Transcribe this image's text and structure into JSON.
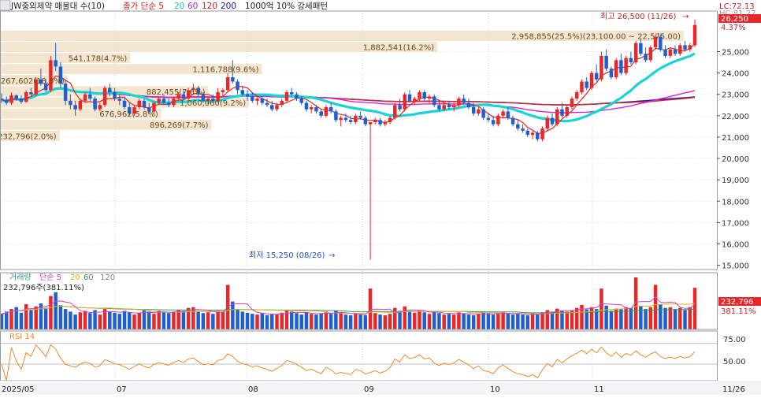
{
  "header": {
    "ticker_label": "JW중외제약 매물대 수(10)",
    "ma_prefix": "종가 단순 5",
    "ma_periods": [
      "20",
      "60",
      "120",
      "200"
    ],
    "volume_info": "1000억 10% 강세패턴"
  },
  "colors": {
    "up": "#e8272b",
    "down": "#1f5fd0",
    "ma5": "#e0281f",
    "ma20": "#19d3d6",
    "ma60": "#e020d8",
    "ma120": "#d12b2b",
    "ma200": "#2020a8",
    "band": "#f1e2c8",
    "rsi": "#f08a2c",
    "vol_ma5": "#d040d0",
    "vol_ma20": "#e0b020",
    "vol_ma60": "#2aa04a"
  },
  "price_panel": {
    "high_annotation": "최고 26,500 (11/26)",
    "low_annotation": "최저 15,250 (08/26)",
    "top_right": {
      "lc": "LC:72.13",
      "hc": "HC:81.27",
      "pct": "4.37%"
    },
    "last_price": "26,250",
    "band_labels": [
      "232,796(2.0%)",
      "896,269(7.7%)",
      "676,962(5.8%)",
      "1,060,060(9.2%)",
      "882,455(7.6%)",
      "267,602(18.0%)",
      "1,116,788(9.6%)",
      "541,178(4.7%)",
      "1,882,541(16.2%)",
      "2,958,855(25.5%)(23,100.00 ~ 22,575.00)"
    ]
  },
  "volume_panel": {
    "label_prefix": "거래량",
    "ma_prefix": "단순 5",
    "ma_periods": [
      "20",
      "60",
      "120"
    ],
    "summary": "232,796주(381.11%)",
    "last_value": "232,796",
    "last_pct": "381.11%"
  },
  "rsi_panel": {
    "label": "RSI 14",
    "ticks": [
      "75.00",
      "50.00"
    ]
  },
  "chart_data": {
    "type": "candlestick",
    "title": "JW중외제약",
    "y_ticks": [
      "25,000",
      "24,000",
      "23,000",
      "22,000",
      "21,000",
      "20,000",
      "19,000",
      "18,000",
      "17,000",
      "16,000",
      "15,000"
    ],
    "ylim": [
      14800,
      26900
    ],
    "x_labels": [
      "2025/05",
      "07",
      "08",
      "09",
      "10",
      "11",
      "11/26"
    ],
    "high": {
      "value": 26500,
      "date": "11/26"
    },
    "low": {
      "value": 15250,
      "date": "08/26"
    },
    "last_close": 26250,
    "volume_profile": [
      {
        "volume": 232796,
        "pct": 2.0
      },
      {
        "volume": 896269,
        "pct": 7.7
      },
      {
        "volume": 676962,
        "pct": 5.8
      },
      {
        "volume": 1060060,
        "pct": 9.2
      },
      {
        "volume": 882455,
        "pct": 7.6
      },
      {
        "volume": 267602,
        "pct": 18.0
      },
      {
        "volume": 1116788,
        "pct": 9.6
      },
      {
        "volume": 541178,
        "pct": 4.7
      },
      {
        "volume": 1882541,
        "pct": 16.2
      },
      {
        "volume": 2958855,
        "pct": 25.5,
        "range": [
          23100,
          22575
        ]
      }
    ],
    "candles": [
      [
        22800,
        23050,
        22600,
        22750
      ],
      [
        22750,
        22900,
        22500,
        22600
      ],
      [
        22600,
        23100,
        22500,
        22950
      ],
      [
        22950,
        23000,
        22700,
        22800
      ],
      [
        22800,
        22950,
        22550,
        22650
      ],
      [
        22650,
        23200,
        22600,
        23100
      ],
      [
        23100,
        23300,
        22900,
        23000
      ],
      [
        23000,
        23800,
        22900,
        23700
      ],
      [
        23700,
        24200,
        23400,
        23500
      ],
      [
        23500,
        23700,
        23100,
        23200
      ],
      [
        23200,
        24800,
        23100,
        24600
      ],
      [
        24600,
        25400,
        24100,
        24300
      ],
      [
        24300,
        24500,
        23300,
        23500
      ],
      [
        23500,
        23700,
        22500,
        22700
      ],
      [
        22700,
        23000,
        22300,
        22500
      ],
      [
        22500,
        22700,
        22000,
        22300
      ],
      [
        22300,
        22800,
        22200,
        22700
      ],
      [
        22700,
        23100,
        22600,
        23000
      ],
      [
        23000,
        23300,
        22700,
        22800
      ],
      [
        22800,
        22900,
        22200,
        22300
      ],
      [
        22300,
        22600,
        22200,
        22500
      ],
      [
        22500,
        23400,
        22400,
        23300
      ],
      [
        23300,
        23500,
        22900,
        23100
      ],
      [
        23100,
        23300,
        22700,
        22800
      ],
      [
        22800,
        23000,
        22500,
        22700
      ],
      [
        22700,
        22900,
        22300,
        22400
      ],
      [
        22400,
        22600,
        22000,
        22100
      ],
      [
        22100,
        22500,
        22000,
        22400
      ],
      [
        22400,
        22800,
        22300,
        22700
      ],
      [
        22700,
        22800,
        22300,
        22400
      ],
      [
        22400,
        22600,
        22100,
        22200
      ],
      [
        22200,
        22700,
        22100,
        22600
      ],
      [
        22600,
        22900,
        22500,
        22800
      ],
      [
        22800,
        23000,
        22500,
        22600
      ],
      [
        22600,
        22800,
        22400,
        22500
      ],
      [
        22500,
        22900,
        22400,
        22800
      ],
      [
        22800,
        23100,
        22700,
        23000
      ],
      [
        23000,
        23200,
        22700,
        22800
      ],
      [
        22800,
        23300,
        22700,
        23200
      ],
      [
        23200,
        23500,
        23000,
        23300
      ],
      [
        23300,
        23400,
        22900,
        23000
      ],
      [
        23000,
        23100,
        22600,
        22700
      ],
      [
        22700,
        22900,
        22500,
        22800
      ],
      [
        22800,
        23000,
        22600,
        22700
      ],
      [
        22700,
        23300,
        22600,
        23100
      ],
      [
        23100,
        23300,
        22900,
        23200
      ],
      [
        23200,
        24000,
        23100,
        23800
      ],
      [
        23800,
        24600,
        23500,
        23600
      ],
      [
        23600,
        23700,
        23000,
        23200
      ],
      [
        23200,
        23400,
        22900,
        23000
      ],
      [
        23000,
        23200,
        22700,
        22900
      ],
      [
        22900,
        23100,
        22600,
        22700
      ],
      [
        22700,
        22900,
        22500,
        22800
      ],
      [
        22800,
        22900,
        22500,
        22600
      ],
      [
        22600,
        22800,
        22400,
        22500
      ],
      [
        22500,
        22700,
        22200,
        22300
      ],
      [
        22300,
        22600,
        22200,
        22500
      ],
      [
        22500,
        22800,
        22400,
        22700
      ],
      [
        22700,
        23200,
        22600,
        23100
      ],
      [
        23100,
        23300,
        22900,
        23000
      ],
      [
        23000,
        23100,
        22700,
        22800
      ],
      [
        22800,
        22900,
        22500,
        22600
      ],
      [
        22600,
        22700,
        22200,
        22300
      ],
      [
        22300,
        22500,
        22100,
        22400
      ],
      [
        22400,
        22500,
        22100,
        22200
      ],
      [
        22200,
        22300,
        21900,
        22000
      ],
      [
        22000,
        22500,
        21900,
        22400
      ],
      [
        22400,
        22600,
        22100,
        22200
      ],
      [
        22200,
        22300,
        21700,
        21800
      ],
      [
        21800,
        22000,
        21500,
        21900
      ],
      [
        21900,
        22100,
        21700,
        21800
      ],
      [
        21800,
        22000,
        21600,
        21700
      ],
      [
        21700,
        22100,
        21600,
        22000
      ],
      [
        22000,
        22200,
        21800,
        21900
      ],
      [
        21900,
        22000,
        21500,
        21600
      ],
      [
        21600,
        21700,
        15250,
        21700
      ],
      [
        21700,
        21900,
        21600,
        21800
      ],
      [
        21800,
        21900,
        21500,
        21600
      ],
      [
        21600,
        21800,
        21500,
        21700
      ],
      [
        21700,
        22000,
        21600,
        21900
      ],
      [
        21900,
        22600,
        21800,
        22500
      ],
      [
        22500,
        22800,
        22200,
        22300
      ],
      [
        22300,
        23100,
        22200,
        23000
      ],
      [
        23000,
        23200,
        22600,
        22700
      ],
      [
        22700,
        22900,
        22500,
        22800
      ],
      [
        22800,
        23200,
        22700,
        23100
      ],
      [
        23100,
        23200,
        22700,
        22800
      ],
      [
        22800,
        23000,
        22600,
        22900
      ],
      [
        22900,
        23000,
        22400,
        22500
      ],
      [
        22500,
        22700,
        22200,
        22300
      ],
      [
        22300,
        22600,
        22200,
        22500
      ],
      [
        22500,
        22700,
        22300,
        22400
      ],
      [
        22400,
        22600,
        22200,
        22500
      ],
      [
        22500,
        22900,
        22400,
        22800
      ],
      [
        22800,
        23000,
        22500,
        22600
      ],
      [
        22600,
        22800,
        22300,
        22400
      ],
      [
        22400,
        22600,
        22000,
        22100
      ],
      [
        22100,
        22400,
        22000,
        22300
      ],
      [
        22300,
        22400,
        21800,
        21900
      ],
      [
        21900,
        22100,
        21700,
        21800
      ],
      [
        21800,
        22000,
        21500,
        21600
      ],
      [
        21600,
        22100,
        21500,
        22000
      ],
      [
        22000,
        22300,
        21900,
        22200
      ],
      [
        22200,
        22400,
        21800,
        21900
      ],
      [
        21900,
        22000,
        21500,
        21600
      ],
      [
        21600,
        21800,
        21300,
        21400
      ],
      [
        21400,
        21600,
        21200,
        21300
      ],
      [
        21300,
        21400,
        21000,
        21100
      ],
      [
        21100,
        21300,
        20900,
        21200
      ],
      [
        21200,
        21300,
        20800,
        20900
      ],
      [
        20900,
        21500,
        20800,
        21400
      ],
      [
        21400,
        22000,
        21300,
        21900
      ],
      [
        21900,
        22100,
        21500,
        21600
      ],
      [
        21600,
        22400,
        21500,
        22300
      ],
      [
        22300,
        22600,
        21900,
        22000
      ],
      [
        22000,
        22500,
        21900,
        22400
      ],
      [
        22400,
        22900,
        22300,
        22800
      ],
      [
        22800,
        23200,
        22700,
        23100
      ],
      [
        23100,
        23700,
        23000,
        23600
      ],
      [
        23600,
        23800,
        23200,
        23300
      ],
      [
        23300,
        24100,
        23200,
        24000
      ],
      [
        24000,
        24400,
        23600,
        23700
      ],
      [
        23700,
        25000,
        23600,
        24800
      ],
      [
        24800,
        25100,
        24100,
        24200
      ],
      [
        24200,
        24300,
        23700,
        23800
      ],
      [
        23800,
        24700,
        23700,
        24600
      ],
      [
        24600,
        24900,
        23900,
        24000
      ],
      [
        24000,
        24800,
        23900,
        24700
      ],
      [
        24700,
        25000,
        24400,
        24500
      ],
      [
        24500,
        25500,
        24400,
        25400
      ],
      [
        25400,
        25600,
        24800,
        24900
      ],
      [
        24900,
        25200,
        24500,
        24600
      ],
      [
        24600,
        25300,
        24500,
        25200
      ],
      [
        25200,
        25800,
        25100,
        25700
      ],
      [
        25700,
        25800,
        25000,
        25100
      ],
      [
        25100,
        25300,
        24700,
        24800
      ],
      [
        24800,
        25200,
        24700,
        25100
      ],
      [
        25100,
        25300,
        24800,
        24900
      ],
      [
        24900,
        25400,
        24800,
        25300
      ],
      [
        25300,
        25500,
        25000,
        25100
      ],
      [
        25100,
        25400,
        25000,
        25300
      ],
      [
        25300,
        26500,
        25200,
        26250
      ]
    ],
    "volumes": [
      42,
      48,
      55,
      60,
      45,
      68,
      52,
      62,
      70,
      58,
      90,
      100,
      65,
      55,
      48,
      40,
      46,
      50,
      44,
      52,
      40,
      55,
      48,
      45,
      42,
      50,
      46,
      40,
      44,
      52,
      48,
      42,
      50,
      46,
      44,
      48,
      52,
      50,
      58,
      60,
      48,
      44,
      46,
      42,
      50,
      48,
      120,
      75,
      55,
      48,
      45,
      42,
      40,
      44,
      38,
      42,
      40,
      45,
      52,
      48,
      44,
      40,
      46,
      42,
      40,
      44,
      48,
      42,
      50,
      45,
      40,
      38,
      42,
      40,
      38,
      110,
      44,
      40,
      38,
      42,
      58,
      50,
      62,
      48,
      45,
      52,
      46,
      42,
      48,
      44,
      40,
      42,
      40,
      46,
      44,
      40,
      38,
      42,
      46,
      44,
      40,
      42,
      46,
      44,
      40,
      42,
      40,
      38,
      44,
      40,
      46,
      52,
      48,
      56,
      50,
      48,
      52,
      58,
      66,
      54,
      60,
      55,
      110,
      64,
      50,
      56,
      54,
      60,
      58,
      140,
      62,
      55,
      60,
      120,
      68,
      58,
      60,
      55,
      58,
      52,
      60,
      112
    ]
  }
}
